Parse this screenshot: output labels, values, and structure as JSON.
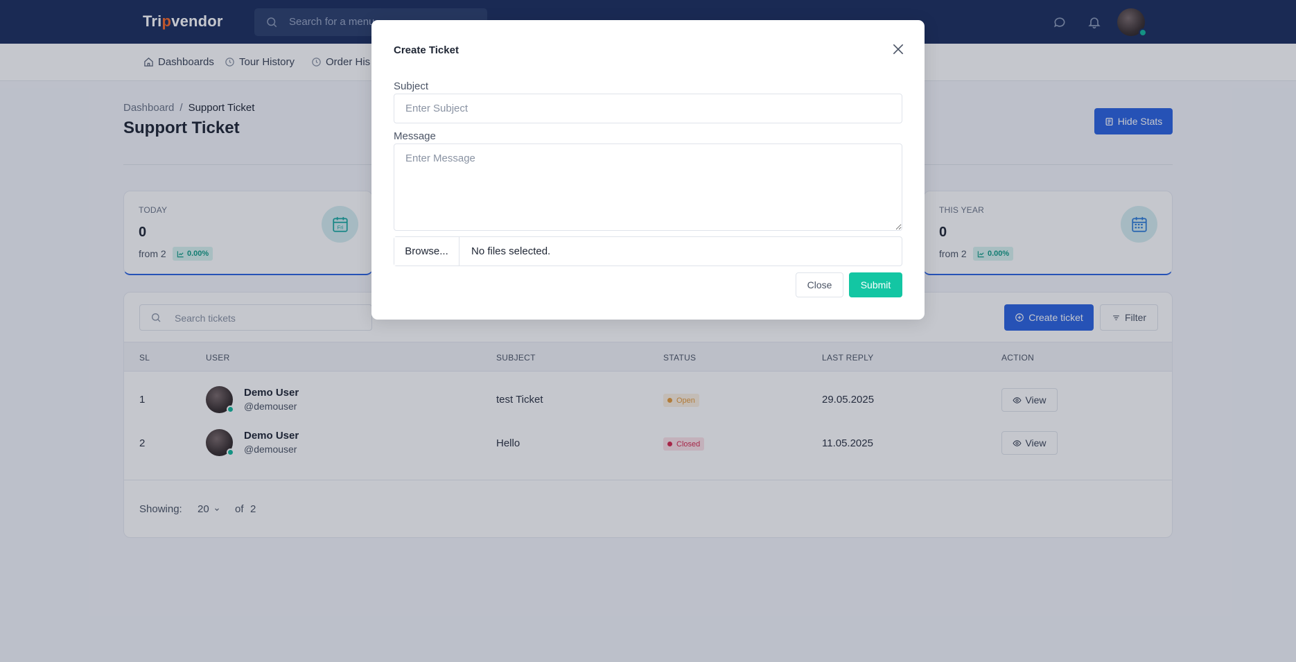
{
  "app": {
    "logo_prefix": "Tri",
    "logo_dot": "p",
    "logo_suffix": "vendor"
  },
  "topbar": {
    "search_placeholder": "Search for a menu",
    "icons": [
      "search-icon",
      "chat-icon",
      "bell-icon",
      "avatar"
    ]
  },
  "subnav": {
    "items": [
      {
        "label": "Dashboards",
        "icon": "home-icon"
      },
      {
        "label": "Tour History",
        "icon": "clock-icon"
      },
      {
        "label": "Order His",
        "icon": "clock-icon"
      }
    ]
  },
  "page": {
    "breadcrumb": {
      "parent": "Dashboard",
      "separator": "/",
      "current": "Support Ticket"
    },
    "title": "Support Ticket",
    "hide_stats_label": "Hide Stats"
  },
  "stats": {
    "today": {
      "label": "TODAY",
      "value": "0",
      "from": "from 2",
      "change": "0.00%",
      "icon": "calendar-day-icon",
      "icon_text": "Fri"
    },
    "this_year": {
      "label": "THIS YEAR",
      "value": "0",
      "from": "from 2",
      "change": "0.00%",
      "icon": "calendar-grid-icon"
    }
  },
  "tickets": {
    "search_placeholder": "Search tickets",
    "create_label": "Create ticket",
    "filter_label": "Filter",
    "columns": [
      "SL",
      "USER",
      "SUBJECT",
      "STATUS",
      "LAST REPLY",
      "ACTION"
    ],
    "rows": [
      {
        "sl": "1",
        "name": "Demo User",
        "handle": "@demouser",
        "subject": "test Ticket",
        "status": "Open",
        "last_reply": "29.05.2025",
        "action": "View"
      },
      {
        "sl": "2",
        "name": "Demo User",
        "handle": "@demouser",
        "subject": "Hello",
        "status": "Closed",
        "last_reply": "11.05.2025",
        "action": "View"
      }
    ],
    "footer": {
      "showing_label": "Showing:",
      "per_page": "20",
      "of_label": "of",
      "total": "2"
    }
  },
  "modal": {
    "title": "Create Ticket",
    "subject_label": "Subject",
    "subject_placeholder": "Enter Subject",
    "message_label": "Message",
    "message_placeholder": "Enter Message",
    "browse_label": "Browse...",
    "file_status": "No files selected.",
    "close_label": "Close",
    "submit_label": "Submit"
  },
  "colors": {
    "navbar": "#1b2e5e",
    "primary": "#2b63e0",
    "success": "#13c6a3",
    "open": "#e59b3b",
    "closed": "#d6284e"
  }
}
